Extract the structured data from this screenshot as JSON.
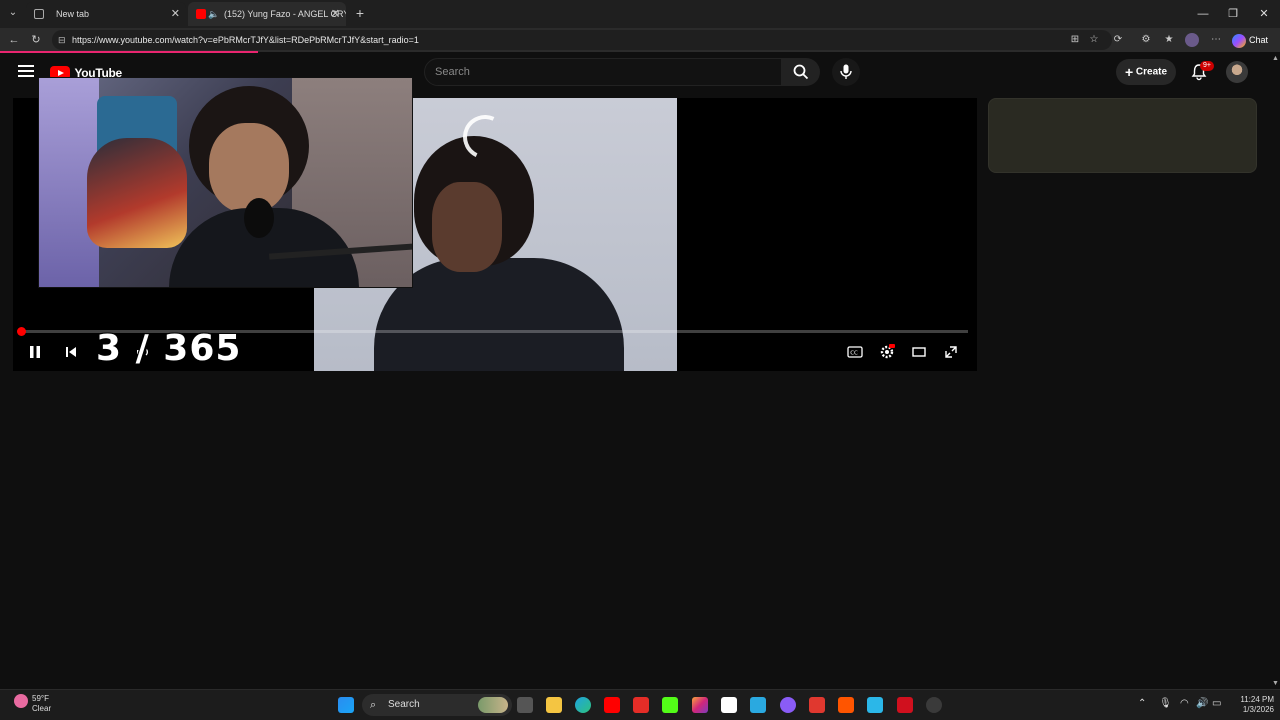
{
  "browser": {
    "tabs": [
      {
        "title": "New tab",
        "active": false
      },
      {
        "title": "(152) Yung Fazo - ANGEL CRY",
        "active": true
      }
    ],
    "url": "https://www.youtube.com/watch?v=ePbRMcrTJfY&list=RDePbRMcrTJfY&start_radio=1",
    "chat_label": "Chat",
    "window_controls": [
      "minimize",
      "maximize",
      "close"
    ]
  },
  "youtube": {
    "logo_text": "YouTube",
    "search_placeholder": "Search",
    "create_label": "Create",
    "notification_count": "9+"
  },
  "player": {
    "state": "playing",
    "progress": 0.003,
    "overlay_counter": "3 / 365",
    "loading": true
  },
  "taskbar": {
    "weather_temp": "59°F",
    "weather_desc": "Clear",
    "search_label": "Search",
    "time": "11:24 PM",
    "date": "1/3/2026"
  },
  "colors": {
    "yt_red": "#ff0000",
    "accent_pink": "#e9256f",
    "bg": "#0f0f0f"
  }
}
